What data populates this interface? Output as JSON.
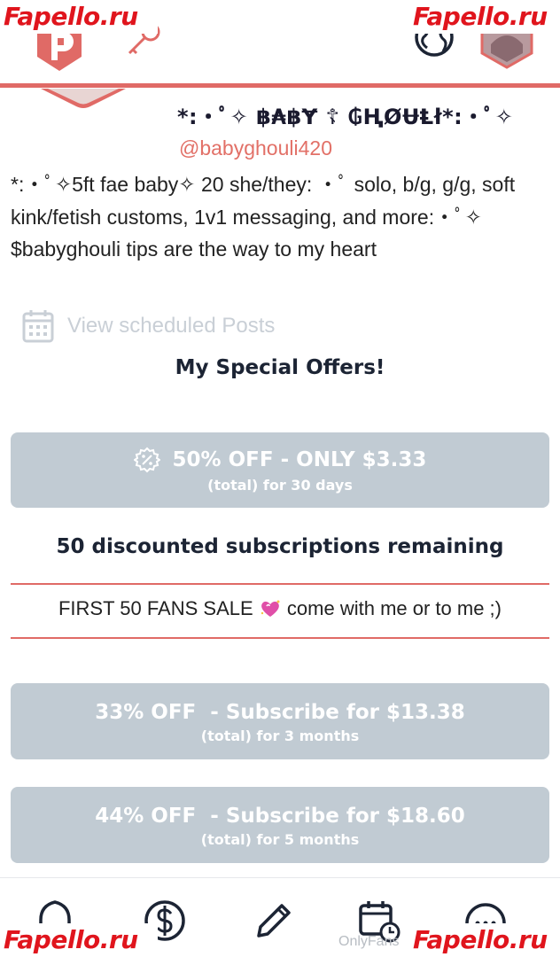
{
  "watermarks": [
    "Fapello.ru",
    "Fapello.ru",
    "Fapello.ru",
    "Fapello.ru"
  ],
  "profile": {
    "name": "*:・ﾟ✧ ฿₳฿Ɏ ☦ ₲ⱧØɄⱠł*:・ﾟ✧",
    "handle": "@babyghouli420",
    "bio": "*:・ﾟ✧5ft fae baby✧ 20 she/they: ・ﾟ solo, b/g, g/g, soft kink/fetish customs, 1v1 messaging, and more:・ﾟ✧ $babyghouli tips are the way to my heart"
  },
  "scheduled_posts_label": "View scheduled Posts",
  "offers": {
    "title": "My Special Offers!",
    "primary": {
      "main": "50% OFF - ONLY $3.33",
      "sub": "(total) for 30 days"
    },
    "remaining_text": "50 discounted subscriptions remaining",
    "sale_text_before": "FIRST 50 FANS SALE",
    "sale_text_after": "come with me or to me ;)",
    "bundles": [
      {
        "main": "33% OFF  - Subscribe for $13.38",
        "sub": "(total) for 3 months"
      },
      {
        "main": "44% OFF  - Subscribe for $18.60",
        "sub": "(total) for 5 months"
      }
    ]
  },
  "footer_brand": "OnlyFans",
  "icons": {
    "logo": "app-logo-icon",
    "key": "key-icon",
    "globe": "globe-icon",
    "discount": "discount-badge-icon",
    "calendar": "calendar-icon",
    "heart": "sparkling-heart-icon",
    "nav": [
      "home-icon",
      "dollar-icon",
      "pencil-icon",
      "calendar-clock-icon",
      "more-icon"
    ]
  },
  "colors": {
    "accent": "#e06a66",
    "button_bg": "#c1cbd3",
    "heading": "#1c2434",
    "muted": "#c9cfd6"
  }
}
